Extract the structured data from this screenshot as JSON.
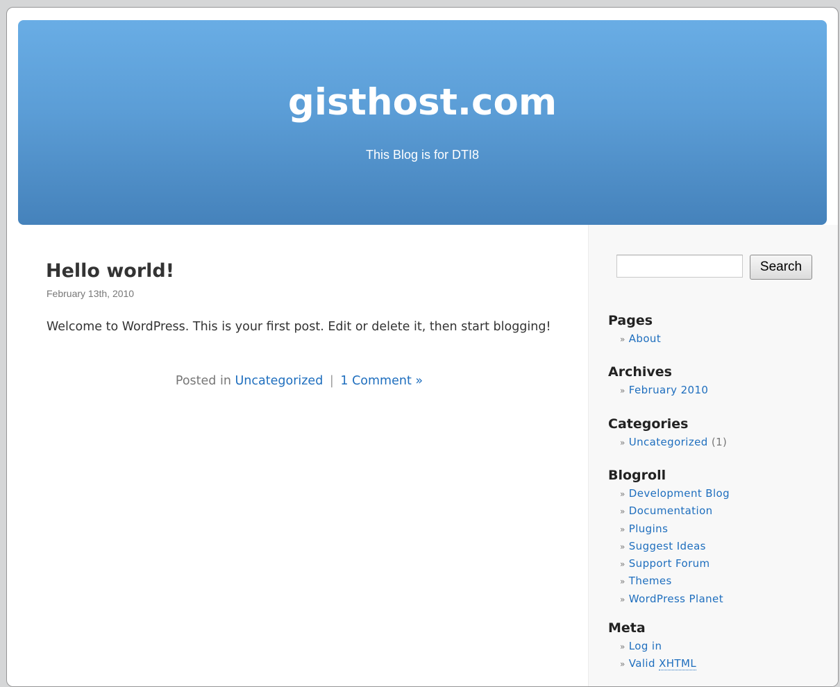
{
  "header": {
    "site_title": "gisthost.com",
    "site_description": "This Blog is for DTI8"
  },
  "post": {
    "title": "Hello world!",
    "date": "February 13th, 2010",
    "body": "Welcome to WordPress. This is your first post. Edit or delete it, then start blogging!",
    "posted_in_label": "Posted in",
    "category": "Uncategorized",
    "separator": "|",
    "comments_link": "1 Comment »"
  },
  "sidebar": {
    "search": {
      "value": "",
      "button_label": "Search"
    },
    "list_bullet": "»",
    "pages": {
      "heading": "Pages",
      "items": [
        "About"
      ]
    },
    "archives": {
      "heading": "Archives",
      "items": [
        "February 2010"
      ]
    },
    "categories": {
      "heading": "Categories",
      "items": [
        {
          "label": "Uncategorized",
          "count": "(1)"
        }
      ]
    },
    "blogroll": {
      "heading": "Blogroll",
      "items": [
        "Development Blog",
        "Documentation",
        "Plugins",
        "Suggest Ideas",
        "Support Forum",
        "Themes",
        "WordPress Planet"
      ]
    },
    "meta": {
      "heading": "Meta",
      "items": [
        {
          "prefix": "",
          "label": "Log in"
        },
        {
          "prefix": "Valid ",
          "label": "XHTML"
        }
      ]
    }
  },
  "colors": {
    "header_top": "#69ade5",
    "header_bottom": "#4582bb",
    "link": "#1e6ebe",
    "sidebar_bg": "#f8f8f8"
  }
}
